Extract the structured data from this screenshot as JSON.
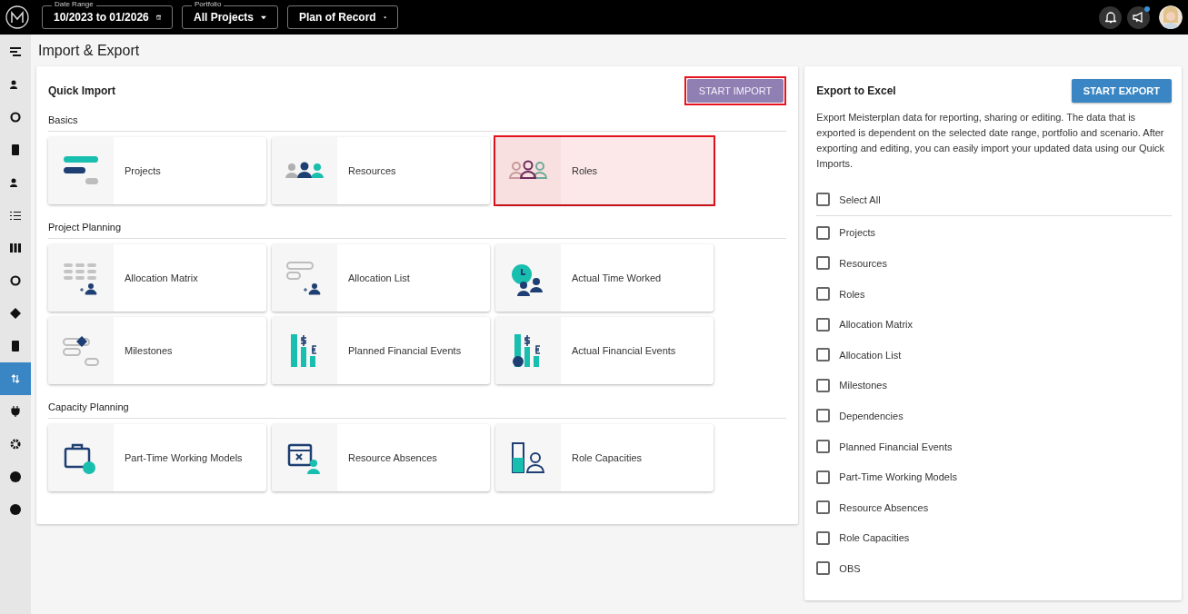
{
  "topbar": {
    "date_range": {
      "label": "Date Range",
      "value": "10/2023 to 01/2026"
    },
    "portfolio": {
      "label": "Portfolio",
      "value": "All Projects"
    },
    "scenario": {
      "value": "Plan of Record"
    },
    "announcements_unread": true
  },
  "sidebar": {
    "items": [
      {
        "selected": false
      },
      {
        "selected": false
      },
      {
        "selected": false
      },
      {
        "selected": false
      },
      {
        "selected": false
      },
      {
        "selected": false
      },
      {
        "selected": false
      },
      {
        "selected": false
      },
      {
        "selected": false
      },
      {
        "selected": false
      },
      {
        "selected": true
      },
      {
        "selected": false
      },
      {
        "selected": false
      },
      {
        "selected": false
      },
      {
        "selected": false
      }
    ]
  },
  "page_title": "Import & Export",
  "quick_import": {
    "title": "Quick Import",
    "button": {
      "label": "START IMPORT",
      "highlighted": true
    },
    "sections": [
      {
        "title": "Basics",
        "tiles": [
          {
            "label": "Projects",
            "highlighted": false
          },
          {
            "label": "Resources",
            "highlighted": false
          },
          {
            "label": "Roles",
            "highlighted": true
          }
        ]
      },
      {
        "title": "Project Planning",
        "tiles": [
          {
            "label": "Allocation Matrix",
            "highlighted": false
          },
          {
            "label": "Allocation List",
            "highlighted": false
          },
          {
            "label": "Actual Time Worked",
            "highlighted": false
          },
          {
            "label": "Milestones",
            "highlighted": false
          },
          {
            "label": "Planned Financial Events",
            "highlighted": false
          },
          {
            "label": "Actual Financial Events",
            "highlighted": false
          }
        ]
      },
      {
        "title": "Capacity Planning",
        "tiles": [
          {
            "label": "Part-Time Working Models",
            "highlighted": false
          },
          {
            "label": "Resource Absences",
            "highlighted": false
          },
          {
            "label": "Role Capacities",
            "highlighted": false
          }
        ]
      }
    ]
  },
  "export": {
    "title": "Export to Excel",
    "button": "START EXPORT",
    "description": "Export Meisterplan data for reporting, sharing or editing. The data that is exported is dependent on the selected date range, portfolio and scenario. After exporting and editing, you can easily import your updated data using our Quick Imports.",
    "select_all": {
      "label": "Select All",
      "checked": false
    },
    "items": [
      {
        "label": "Projects",
        "checked": false
      },
      {
        "label": "Resources",
        "checked": false
      },
      {
        "label": "Roles",
        "checked": false
      },
      {
        "label": "Allocation Matrix",
        "checked": false
      },
      {
        "label": "Allocation List",
        "checked": false
      },
      {
        "label": "Milestones",
        "checked": false
      },
      {
        "label": "Dependencies",
        "checked": false
      },
      {
        "label": "Planned Financial Events",
        "checked": false
      },
      {
        "label": "Part-Time Working Models",
        "checked": false
      },
      {
        "label": "Resource Absences",
        "checked": false
      },
      {
        "label": "Role Capacities",
        "checked": false
      },
      {
        "label": "OBS",
        "checked": false
      }
    ]
  }
}
